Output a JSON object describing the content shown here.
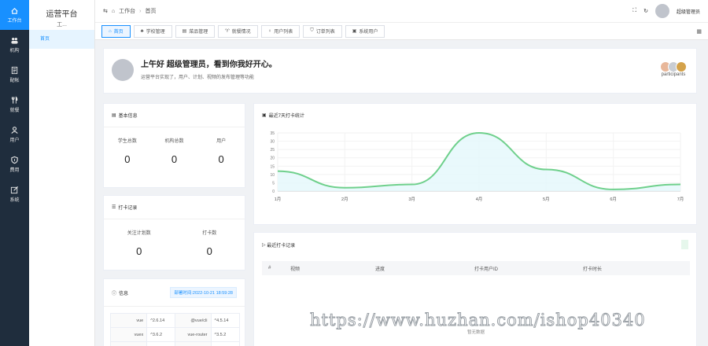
{
  "rail": [
    {
      "label": "工作台",
      "icon": "home-icon",
      "active": true
    },
    {
      "label": "机构",
      "icon": "users-icon"
    },
    {
      "label": "配帐",
      "icon": "document-icon"
    },
    {
      "label": "就餐",
      "icon": "utensils-icon"
    },
    {
      "label": "用户",
      "icon": "user-icon"
    },
    {
      "label": "费用",
      "icon": "shield-icon"
    },
    {
      "label": "系统",
      "icon": "edit-icon"
    }
  ],
  "sidebar": {
    "title": "运营平台",
    "subtitle": "工...",
    "items": [
      "首页"
    ]
  },
  "header": {
    "breadcrumb": [
      "工作台",
      "首页"
    ],
    "username": "超级管理员"
  },
  "tabs": [
    "首页",
    "学校管理",
    "菜品管理",
    "就餐情况",
    "用户列表",
    "订单列表",
    "系统用户"
  ],
  "welcome": {
    "greeting": "上午好 超级管理员，看到你我好开心。",
    "desc": "运营平台实现了，用户、计划、视频的发布管理等功能",
    "participants_label": "participants",
    "participant_colors": [
      "#e8b79a",
      "#c9cdd3",
      "#d4a24a"
    ]
  },
  "basic_info": {
    "title": "基本信息",
    "stats": [
      {
        "label": "学生总数",
        "value": "0"
      },
      {
        "label": "机构总数",
        "value": "0"
      },
      {
        "label": "用户",
        "value": "0"
      }
    ]
  },
  "chart_title": "最近7天打卡统计",
  "chart_data": {
    "type": "area",
    "categories": [
      "1月",
      "2月",
      "3月",
      "4月",
      "5月",
      "6月",
      "7月"
    ],
    "values": [
      12,
      2,
      4,
      35,
      13,
      1,
      4
    ],
    "ylim": [
      0,
      35
    ],
    "yticks": [
      0,
      5,
      10,
      15,
      20,
      25,
      30,
      35
    ],
    "line_color": "#6fd08c",
    "fill_color": "#e3f7fb"
  },
  "checkin": {
    "title": "打卡记录",
    "stats": [
      {
        "label": "关注计划数",
        "value": "0"
      },
      {
        "label": "打卡数",
        "value": "0"
      }
    ]
  },
  "info": {
    "title": "信息",
    "deploy_time": "部署时间:2022-10-21 18:59:28",
    "rows": [
      [
        "vue",
        "^2.6.14",
        "@vue/cli",
        "^4.5.14"
      ],
      [
        "vuex",
        "^3.6.2",
        "vue-router",
        "^3.5.2"
      ],
      [
        "element-ui",
        "^2.15.5",
        "node",
        "16.20.0"
      ]
    ]
  },
  "recent": {
    "title": "最近打卡记录",
    "columns": [
      "#",
      "视频",
      "进度",
      "打卡用户ID",
      "打卡时长"
    ],
    "empty_text": "暂无数据"
  },
  "watermark": "https://www.huzhan.com/ishop40340"
}
